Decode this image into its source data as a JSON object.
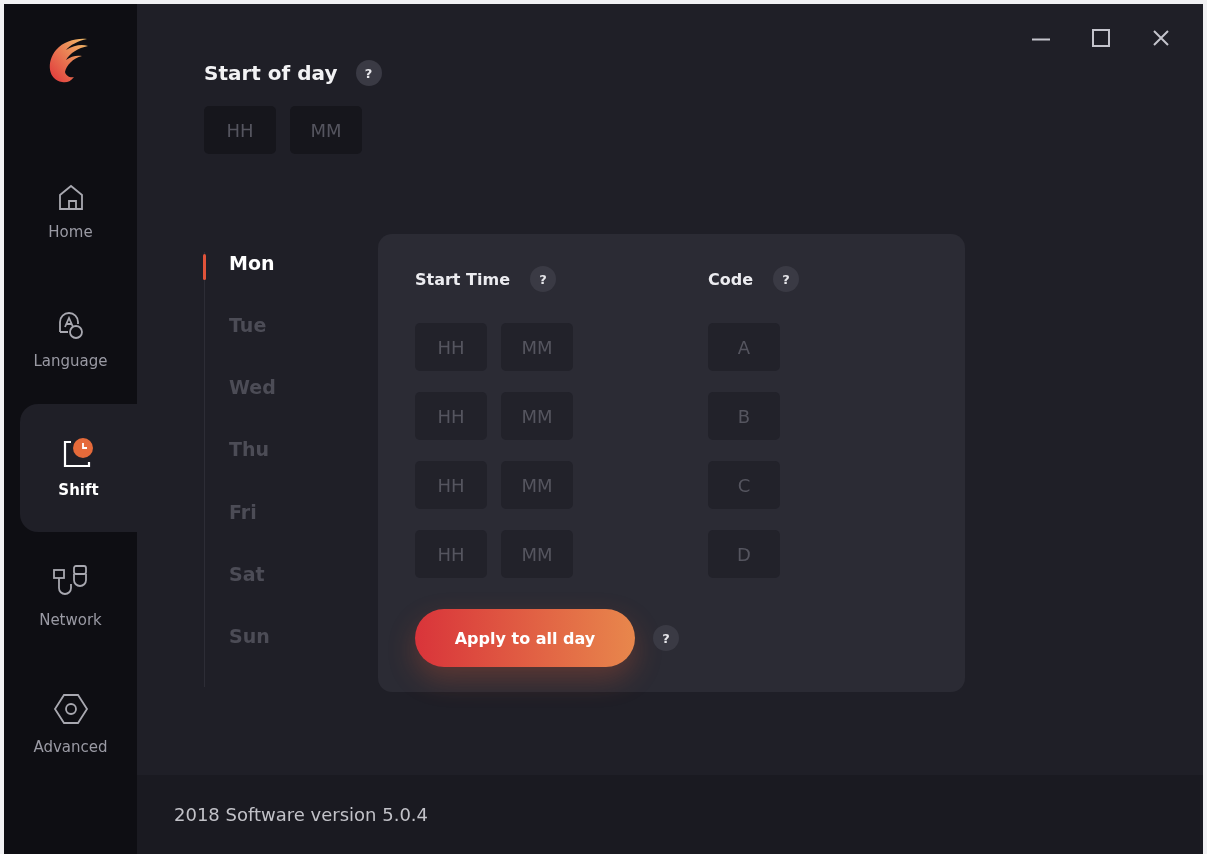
{
  "sidebar": {
    "items": [
      {
        "kind": "home",
        "label": "Home",
        "selected": false
      },
      {
        "kind": "language",
        "label": "Language",
        "selected": false
      },
      {
        "kind": "shift",
        "label": "Shift",
        "selected": true
      },
      {
        "kind": "network",
        "label": "Network",
        "selected": false
      },
      {
        "kind": "advanced",
        "label": "Advanced",
        "selected": false
      }
    ]
  },
  "start_of_day": {
    "title": "Start of day",
    "help": "?",
    "hour_placeholder": "HH",
    "minute_placeholder": "MM"
  },
  "days": [
    {
      "label": "Mon",
      "selected": true
    },
    {
      "label": "Tue",
      "selected": false
    },
    {
      "label": "Wed",
      "selected": false
    },
    {
      "label": "Thu",
      "selected": false
    },
    {
      "label": "Fri",
      "selected": false
    },
    {
      "label": "Sat",
      "selected": false
    },
    {
      "label": "Sun",
      "selected": false
    }
  ],
  "card": {
    "start_time_label": "Start Time",
    "start_time_help": "?",
    "code_label": "Code",
    "code_help": "?",
    "rows": [
      {
        "hour_placeholder": "HH",
        "minute_placeholder": "MM",
        "code_placeholder": "A"
      },
      {
        "hour_placeholder": "HH",
        "minute_placeholder": "MM",
        "code_placeholder": "B"
      },
      {
        "hour_placeholder": "HH",
        "minute_placeholder": "MM",
        "code_placeholder": "C"
      },
      {
        "hour_placeholder": "HH",
        "minute_placeholder": "MM",
        "code_placeholder": "D"
      }
    ],
    "apply_button": "Apply to all day",
    "apply_help": "?"
  },
  "footer": {
    "version": "2018 Software version 5.0.4"
  }
}
